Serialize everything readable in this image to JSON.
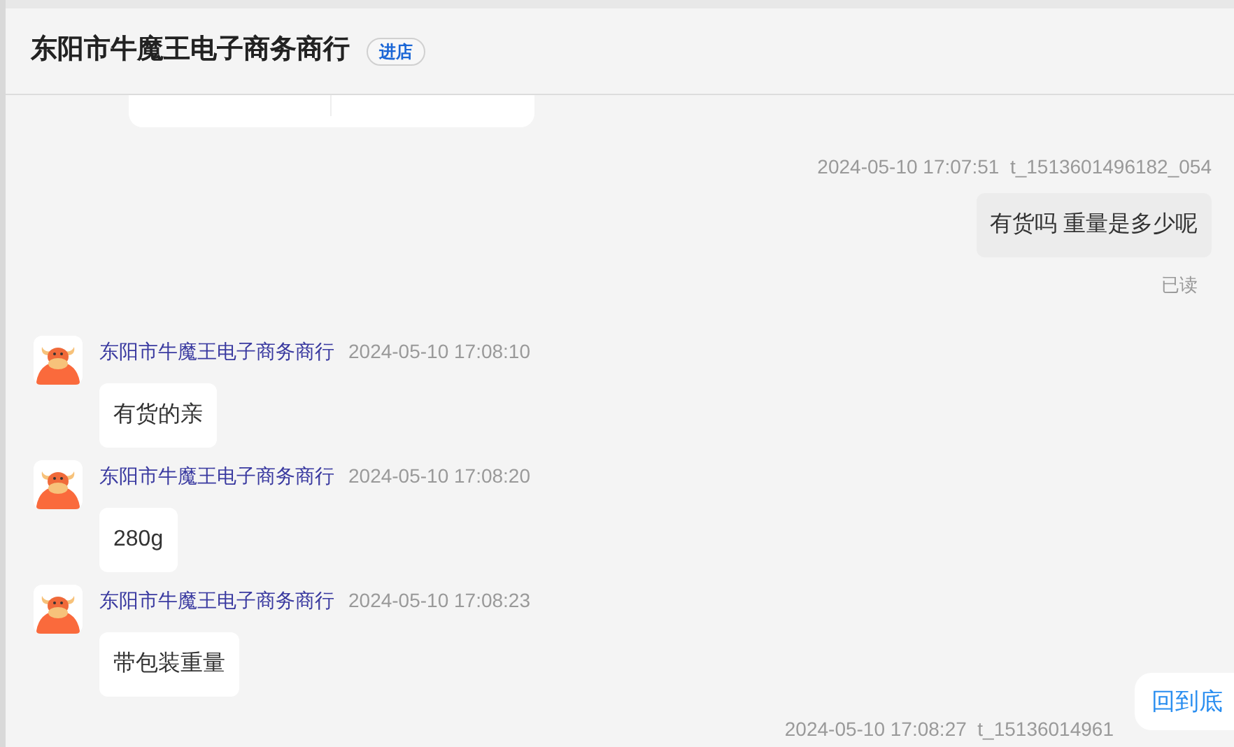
{
  "header": {
    "title": "东阳市牛魔王电子商务商行",
    "store_button": "进店"
  },
  "messages": [
    {
      "kind": "card"
    },
    {
      "kind": "outgoing",
      "time": "2024-05-10 17:07:51",
      "sender_id": "t_1513601496182_054",
      "text": "有货吗 重量是多少呢",
      "read_label": "已读"
    },
    {
      "kind": "incoming",
      "sender": "东阳市牛魔王电子商务商行",
      "time": "2024-05-10 17:08:10",
      "text": "有货的亲"
    },
    {
      "kind": "incoming",
      "sender": "东阳市牛魔王电子商务商行",
      "time": "2024-05-10 17:08:20",
      "text": "280g"
    },
    {
      "kind": "incoming",
      "sender": "东阳市牛魔王电子商务商行",
      "time": "2024-05-10 17:08:23",
      "text": "带包装重量"
    },
    {
      "kind": "outgoing",
      "time": "2024-05-10 17:08:27",
      "sender_id": "t_15136014961"
    }
  ],
  "scroll_button": "回到底"
}
